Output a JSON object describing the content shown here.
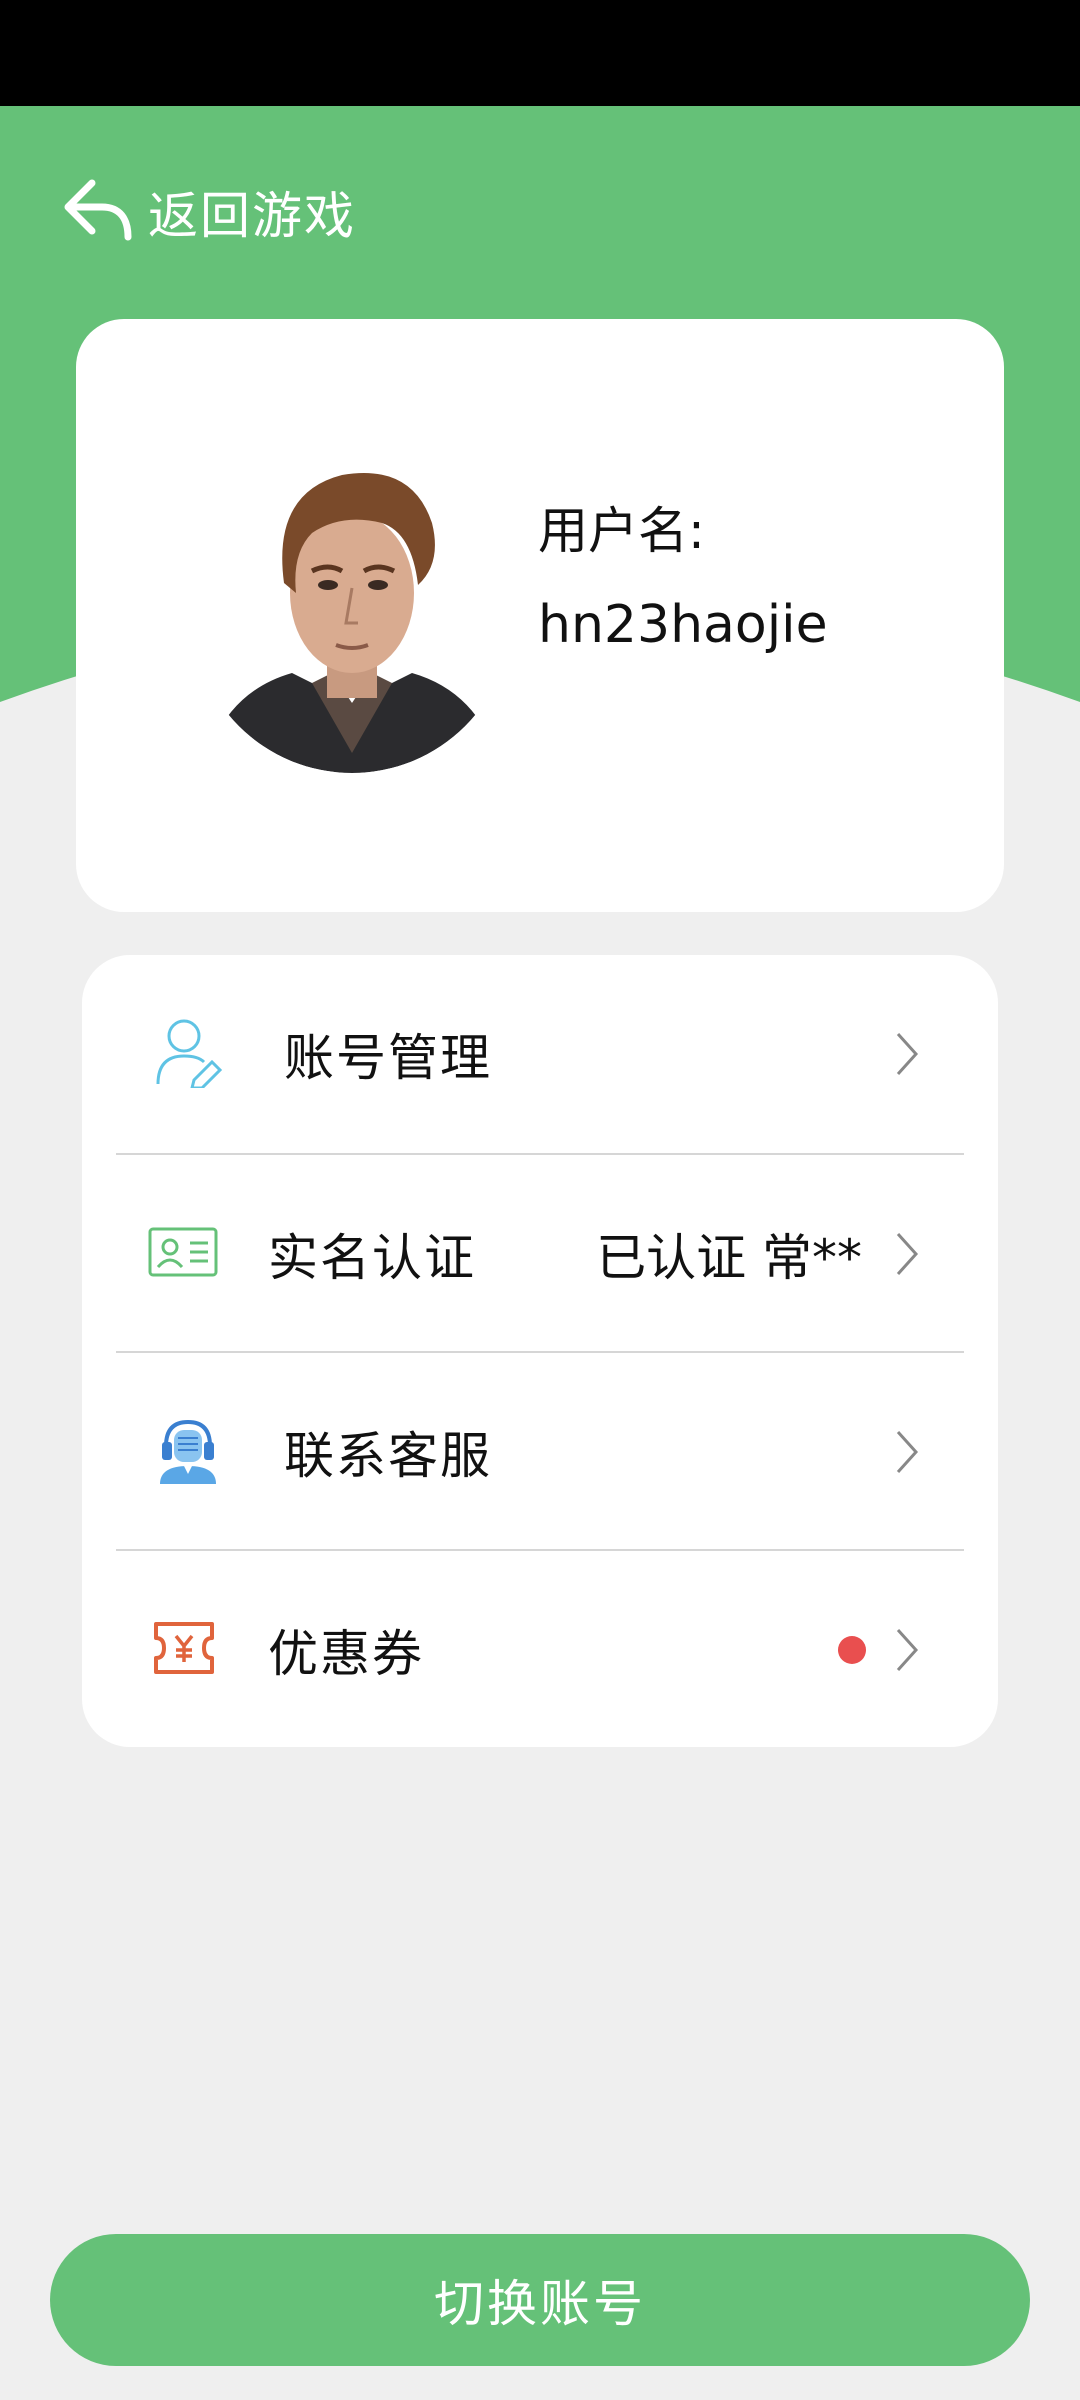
{
  "header": {
    "back_label": "返回游戏"
  },
  "profile": {
    "username_label": "用户名:",
    "username": "hn23haojie"
  },
  "menu": {
    "items": [
      {
        "icon": "user-edit-icon",
        "label": "账号管理",
        "value": ""
      },
      {
        "icon": "id-card-icon",
        "label": "实名认证",
        "value": "已认证 常**"
      },
      {
        "icon": "customer-service-icon",
        "label": "联系客服",
        "value": ""
      },
      {
        "icon": "coupon-icon",
        "label": "优惠券",
        "value": "",
        "has_badge": true
      }
    ]
  },
  "footer": {
    "switch_account_label": "切换账号"
  },
  "colors": {
    "primary_green": "#65c178",
    "badge_red": "#e94f4f",
    "page_background": "#efefef"
  }
}
